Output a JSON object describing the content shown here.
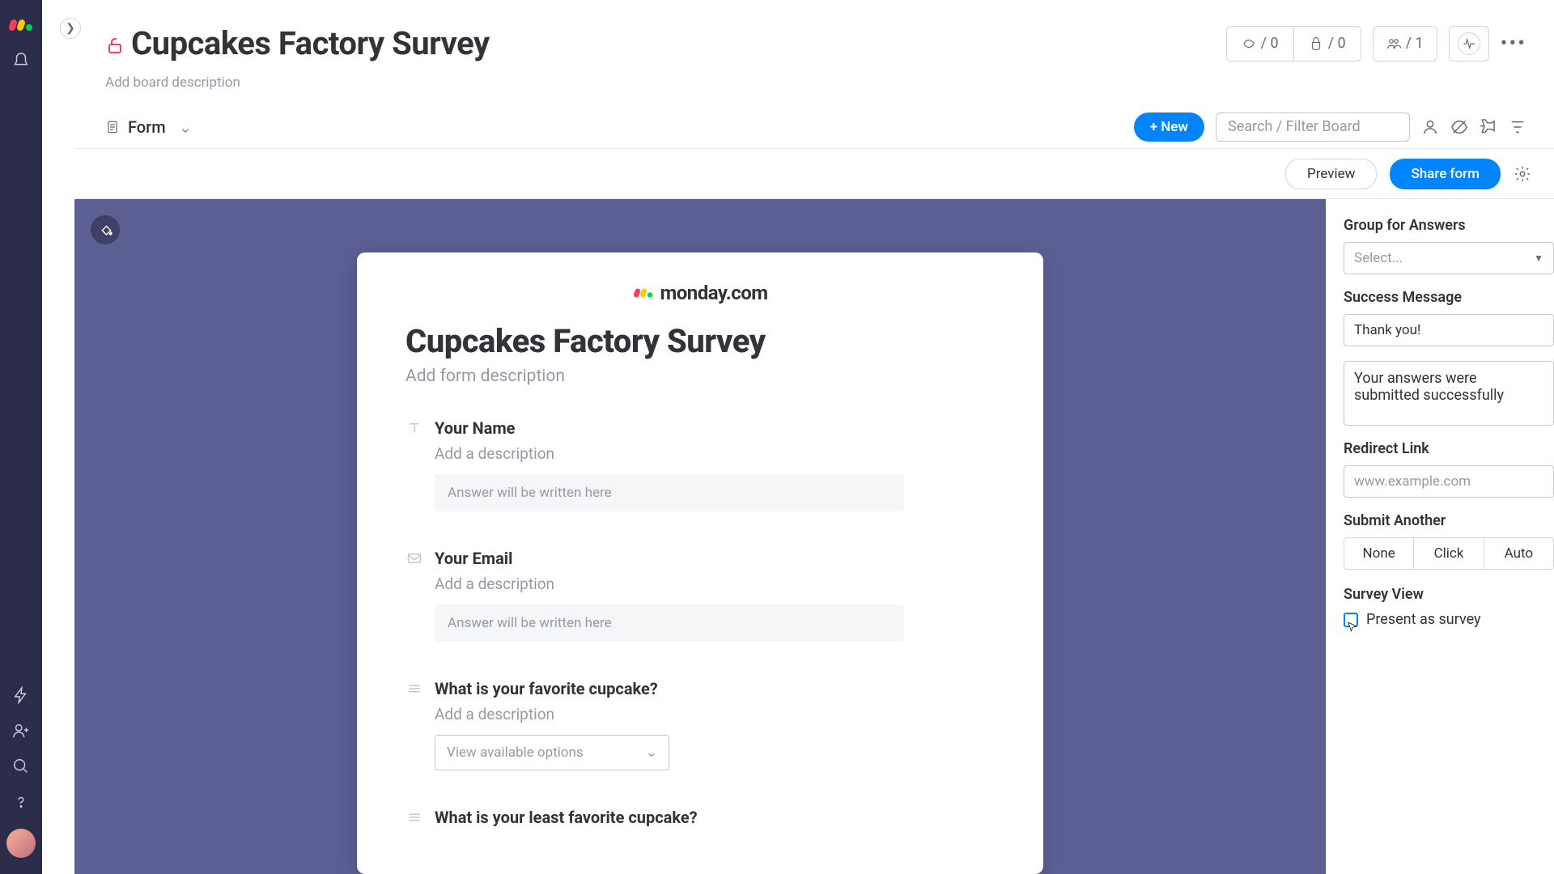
{
  "board": {
    "title": "Cupcakes Factory Survey",
    "description_placeholder": "Add board description"
  },
  "header": {
    "automations_count": "/ 0",
    "integrations_count": "/ 0",
    "members_count": "/ 1"
  },
  "tabs": {
    "form_label": "Form",
    "new_button": "+ New",
    "search_placeholder": "Search / Filter Board"
  },
  "actions": {
    "preview": "Preview",
    "share": "Share form"
  },
  "brand": {
    "name": "monday.com"
  },
  "form": {
    "title": "Cupcakes Factory Survey",
    "description_placeholder": "Add form description",
    "fields": [
      {
        "label": "Your Name",
        "description": "Add a description",
        "placeholder": "Answer will be written here",
        "type": "text"
      },
      {
        "label": "Your Email",
        "description": "Add a description",
        "placeholder": "Answer will be written here",
        "type": "email"
      },
      {
        "label": "What is your favorite cupcake?",
        "description": "Add a description",
        "placeholder": "View available options",
        "type": "select"
      },
      {
        "label": "What is your least favorite cupcake?",
        "description": "",
        "placeholder": "",
        "type": "select"
      }
    ]
  },
  "settings": {
    "group_label": "Group for Answers",
    "group_placeholder": "Select...",
    "success_label": "Success Message",
    "success_title_value": "Thank you!",
    "success_body_value": "Your answers were submitted successfully",
    "redirect_label": "Redirect Link",
    "redirect_placeholder": "www.example.com",
    "submit_another_label": "Submit Another",
    "submit_options": {
      "none": "None",
      "click": "Click",
      "auto": "Auto"
    },
    "survey_view_label": "Survey View",
    "present_as_survey": "Present as survey"
  }
}
